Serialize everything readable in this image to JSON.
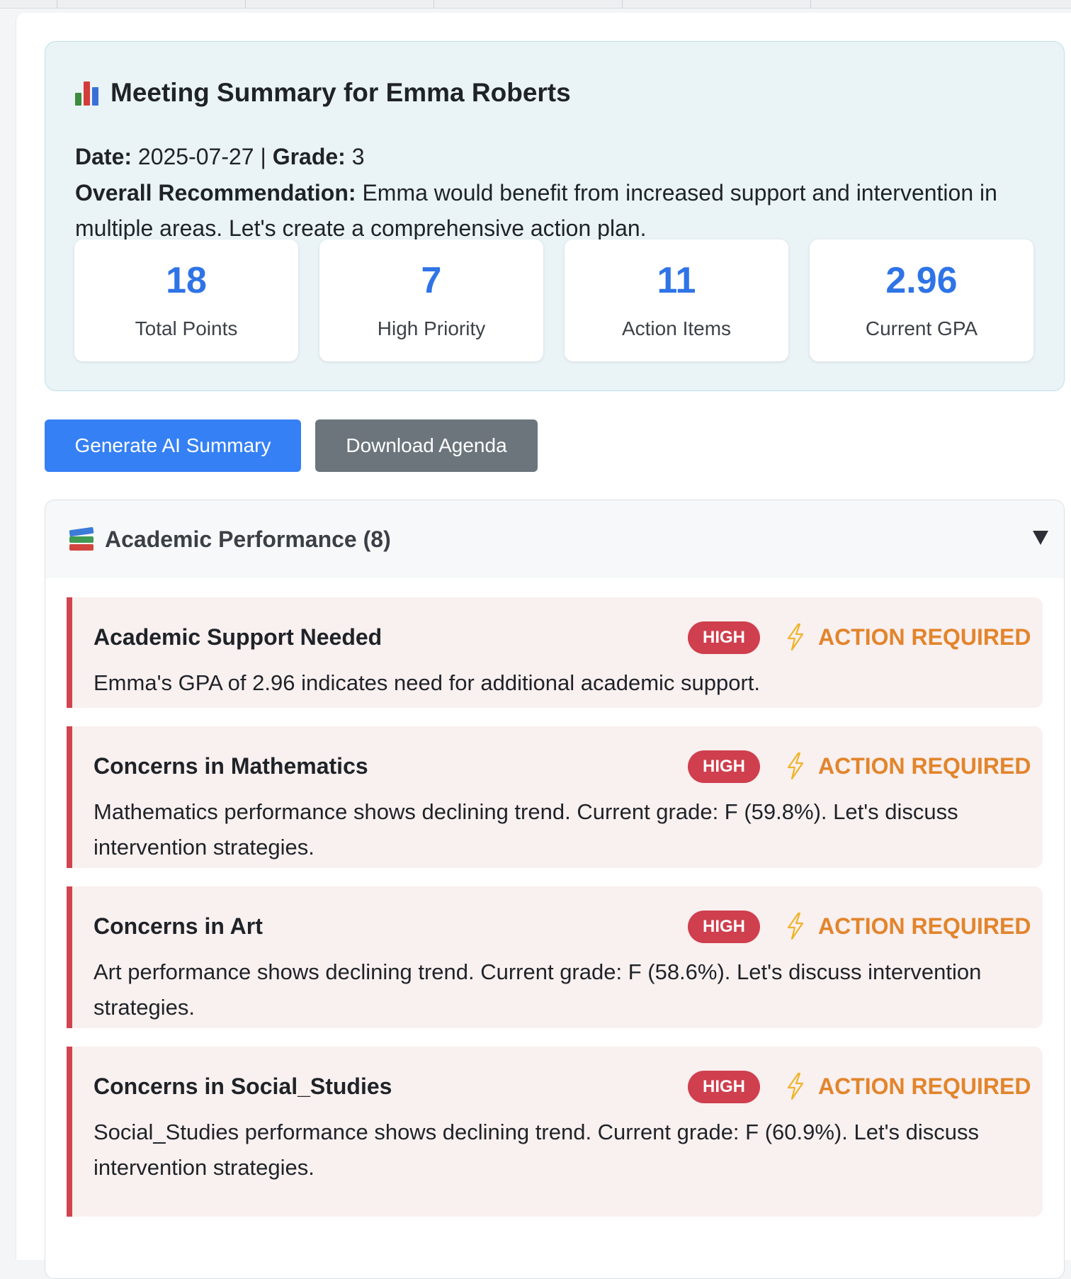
{
  "summary": {
    "title": "Meeting Summary for Emma Roberts",
    "date_label": "Date:",
    "date_value": "2025-07-27",
    "separator": "|",
    "grade_label": "Grade:",
    "grade_value": "3",
    "recommendation_label": "Overall Recommendation:",
    "recommendation_text": "Emma would benefit from increased support and intervention in multiple areas. Let's create a comprehensive action plan.",
    "stats": [
      {
        "value": "18",
        "label": "Total Points"
      },
      {
        "value": "7",
        "label": "High Priority"
      },
      {
        "value": "11",
        "label": "Action Items"
      },
      {
        "value": "2.96",
        "label": "Current GPA"
      }
    ]
  },
  "buttons": {
    "generate": "Generate AI Summary",
    "download": "Download Agenda"
  },
  "section": {
    "title": "Academic Performance (8)",
    "items": [
      {
        "title": "Academic Support Needed",
        "priority": "HIGH",
        "action": "ACTION REQUIRED",
        "text": "Emma's GPA of 2.96 indicates need for additional academic support."
      },
      {
        "title": "Concerns in Mathematics",
        "priority": "HIGH",
        "action": "ACTION REQUIRED",
        "text": "Mathematics performance shows declining trend. Current grade: F (59.8%). Let's discuss intervention strategies."
      },
      {
        "title": "Concerns in Art",
        "priority": "HIGH",
        "action": "ACTION REQUIRED",
        "text": "Art performance shows declining trend. Current grade: F (58.6%). Let's discuss intervention strategies."
      },
      {
        "title": "Concerns in Social_Studies",
        "priority": "HIGH",
        "action": "ACTION REQUIRED",
        "text": "Social_Studies performance shows declining trend. Current grade: F (60.9%). Let's discuss intervention strategies."
      }
    ]
  },
  "icons": {
    "summary": "bar-chart-icon",
    "section": "books-icon",
    "toggle": "chevron-down-icon",
    "action": "lightning-bolt-icon"
  },
  "colors": {
    "accent_blue": "#3580f4",
    "stat_blue": "#2f74e6",
    "secondary_gray": "#6c757c",
    "high_badge": "#cf3f4d",
    "action_orange": "#e2852c",
    "card_bg": "#f9f0f0",
    "summary_bg": "#eaf3f6"
  }
}
